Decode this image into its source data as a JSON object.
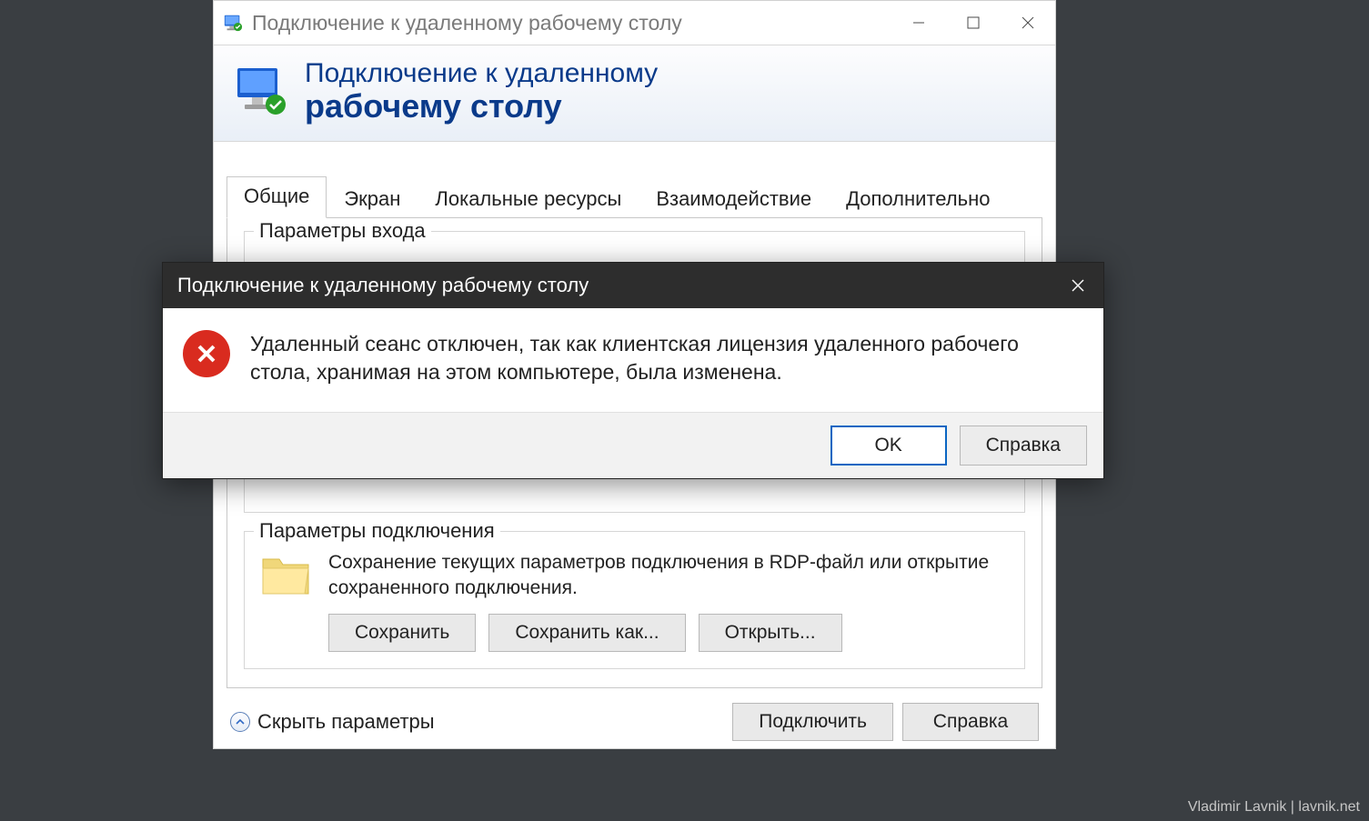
{
  "mainWindow": {
    "title": "Подключение к удаленному рабочему столу",
    "banner": {
      "line1": "Подключение к удаленному",
      "line2": "рабочему столу"
    },
    "tabs": [
      {
        "label": "Общие"
      },
      {
        "label": "Экран"
      },
      {
        "label": "Локальные ресурсы"
      },
      {
        "label": "Взаимодействие"
      },
      {
        "label": "Дополнительно"
      }
    ],
    "loginGroupTitle": "Параметры входа",
    "connGroup": {
      "title": "Параметры подключения",
      "desc": "Сохранение текущих параметров подключения в RDP-файл или открытие сохраненного подключения.",
      "saveBtn": "Сохранить",
      "saveAsBtn": "Сохранить как...",
      "openBtn": "Открыть..."
    },
    "toggleOptions": "Скрыть параметры",
    "connectBtn": "Подключить",
    "helpBtn": "Справка"
  },
  "errorModal": {
    "title": "Подключение к удаленному рабочему столу",
    "message": "Удаленный сеанс отключен, так как клиентская лицензия удаленного рабочего стола, хранимая на этом компьютере, была изменена.",
    "okBtn": "OK",
    "helpBtn": "Справка"
  },
  "watermark": "Vladimir Lavnik | lavnik.net"
}
